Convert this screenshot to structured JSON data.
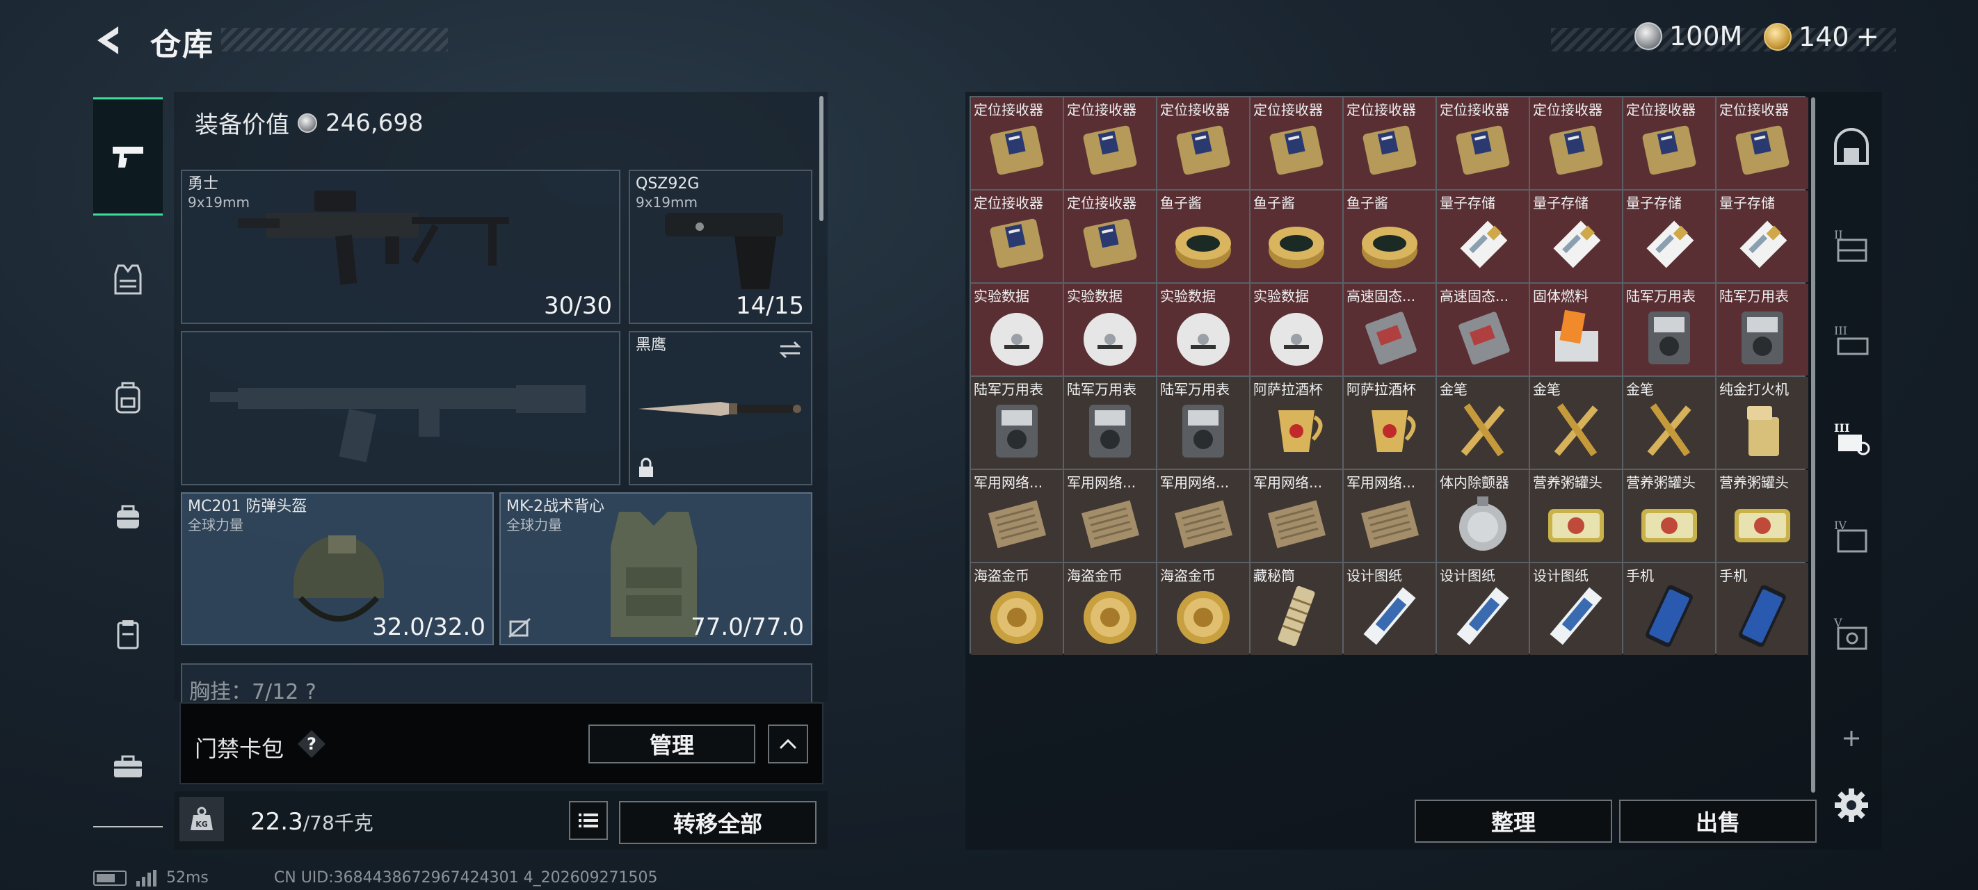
{
  "header": {
    "title": "仓库",
    "currency_silver": "100M",
    "currency_gold": "140",
    "plus_label": "+"
  },
  "left_rail": {
    "items": [
      {
        "name": "weapons",
        "icon": "pistol-icon",
        "active": true
      },
      {
        "name": "vests",
        "icon": "vest-icon"
      },
      {
        "name": "backpacks",
        "icon": "backpack-icon"
      },
      {
        "name": "bags",
        "icon": "bag-icon"
      },
      {
        "name": "containers",
        "icon": "clipboard-icon"
      },
      {
        "name": "toolbox",
        "icon": "toolbox-icon"
      }
    ]
  },
  "equipment": {
    "value_label": "装备价值",
    "value": "246,698",
    "primary": {
      "name": "勇士",
      "caliber": "9x19mm",
      "ammo": "30/30"
    },
    "sidearm": {
      "name": "QSZ92G",
      "caliber": "9x19mm",
      "ammo": "14/15"
    },
    "melee": {
      "name": "黑鹰"
    },
    "helmet": {
      "name": "MC201 防弹头盔",
      "brand": "全球力量",
      "durability": "32.0/32.0"
    },
    "armor": {
      "name": "MK-2战术背心",
      "brand": "全球力量",
      "durability": "77.0/77.0"
    },
    "chest_partial": "胸挂：7/12   ?",
    "card_pack_label": "门禁卡包",
    "manage_label": "管理",
    "weight_value": "22.3",
    "weight_unit": "/78千克",
    "transfer_label": "转移全部"
  },
  "status": {
    "latency": "52ms",
    "uid": "CN UID:3684438672967424301 4_202609271505"
  },
  "storage": {
    "sort_label": "整理",
    "sell_label": "出售",
    "items": [
      {
        "name": "定位接收器",
        "kind": "receiver",
        "bg": "red"
      },
      {
        "name": "定位接收器",
        "kind": "receiver",
        "bg": "red"
      },
      {
        "name": "定位接收器",
        "kind": "receiver",
        "bg": "red"
      },
      {
        "name": "定位接收器",
        "kind": "receiver",
        "bg": "red"
      },
      {
        "name": "定位接收器",
        "kind": "receiver",
        "bg": "red"
      },
      {
        "name": "定位接收器",
        "kind": "receiver",
        "bg": "red"
      },
      {
        "name": "定位接收器",
        "kind": "receiver",
        "bg": "red"
      },
      {
        "name": "定位接收器",
        "kind": "receiver",
        "bg": "red"
      },
      {
        "name": "定位接收器",
        "kind": "receiver",
        "bg": "red"
      },
      {
        "name": "定位接收器",
        "kind": "receiver",
        "bg": "red"
      },
      {
        "name": "定位接收器",
        "kind": "receiver",
        "bg": "red"
      },
      {
        "name": "鱼子酱",
        "kind": "caviar",
        "bg": "red"
      },
      {
        "name": "鱼子酱",
        "kind": "caviar",
        "bg": "red"
      },
      {
        "name": "鱼子酱",
        "kind": "caviar",
        "bg": "red"
      },
      {
        "name": "量子存储",
        "kind": "usb",
        "bg": "red"
      },
      {
        "name": "量子存储",
        "kind": "usb",
        "bg": "red"
      },
      {
        "name": "量子存储",
        "kind": "usb",
        "bg": "red"
      },
      {
        "name": "量子存储",
        "kind": "usb",
        "bg": "red"
      },
      {
        "name": "实验数据",
        "kind": "disc",
        "bg": "red"
      },
      {
        "name": "实验数据",
        "kind": "disc",
        "bg": "red"
      },
      {
        "name": "实验数据",
        "kind": "disc",
        "bg": "red"
      },
      {
        "name": "实验数据",
        "kind": "disc",
        "bg": "red"
      },
      {
        "name": "高速固态...",
        "kind": "ssd",
        "bg": "red"
      },
      {
        "name": "高速固态...",
        "kind": "ssd",
        "bg": "red"
      },
      {
        "name": "固体燃料",
        "kind": "fuel",
        "bg": "red"
      },
      {
        "name": "陆军万用表",
        "kind": "meter",
        "bg": "red"
      },
      {
        "name": "陆军万用表",
        "kind": "meter",
        "bg": "red"
      },
      {
        "name": "陆军万用表",
        "kind": "meter",
        "bg": "brown"
      },
      {
        "name": "陆军万用表",
        "kind": "meter",
        "bg": "brown"
      },
      {
        "name": "陆军万用表",
        "kind": "meter",
        "bg": "brown"
      },
      {
        "name": "阿萨拉酒杯",
        "kind": "cup",
        "bg": "brown"
      },
      {
        "name": "阿萨拉酒杯",
        "kind": "cup",
        "bg": "brown"
      },
      {
        "name": "金笔",
        "kind": "pen",
        "bg": "brown"
      },
      {
        "name": "金笔",
        "kind": "pen",
        "bg": "brown"
      },
      {
        "name": "金笔",
        "kind": "pen",
        "bg": "brown"
      },
      {
        "name": "纯金打火机",
        "kind": "lighter",
        "bg": "brown"
      },
      {
        "name": "军用网络...",
        "kind": "network",
        "bg": "brown"
      },
      {
        "name": "军用网络...",
        "kind": "network",
        "bg": "brown"
      },
      {
        "name": "军用网络...",
        "kind": "network",
        "bg": "brown"
      },
      {
        "name": "军用网络...",
        "kind": "network",
        "bg": "brown"
      },
      {
        "name": "军用网络...",
        "kind": "network",
        "bg": "brown"
      },
      {
        "name": "体内除颤器",
        "kind": "defib",
        "bg": "brown"
      },
      {
        "name": "营养粥罐头",
        "kind": "can",
        "bg": "brown"
      },
      {
        "name": "营养粥罐头",
        "kind": "can",
        "bg": "brown"
      },
      {
        "name": "营养粥罐头",
        "kind": "can",
        "bg": "brown"
      },
      {
        "name": "海盗金币",
        "kind": "coin",
        "bg": "brown"
      },
      {
        "name": "海盗金币",
        "kind": "coin",
        "bg": "brown"
      },
      {
        "name": "海盗金币",
        "kind": "coin",
        "bg": "brown"
      },
      {
        "name": "藏秘筒",
        "kind": "cryptex",
        "bg": "brown"
      },
      {
        "name": "设计图纸",
        "kind": "blueprint",
        "bg": "brown"
      },
      {
        "name": "设计图纸",
        "kind": "blueprint",
        "bg": "brown"
      },
      {
        "name": "设计图纸",
        "kind": "blueprint",
        "bg": "brown"
      },
      {
        "name": "手机",
        "kind": "phone",
        "bg": "brown"
      },
      {
        "name": "手机",
        "kind": "phone",
        "bg": "brown"
      }
    ]
  },
  "right_rail": {
    "items": [
      {
        "name": "storage-main",
        "icon": "vault-icon"
      },
      {
        "name": "storage-2",
        "icon": "shelf-2-icon"
      },
      {
        "name": "storage-3",
        "icon": "shelf-3-icon"
      },
      {
        "name": "storage-3b",
        "icon": "shelf-3b-icon"
      },
      {
        "name": "storage-4",
        "icon": "shelf-4-icon"
      },
      {
        "name": "storage-5",
        "icon": "shelf-5-icon"
      },
      {
        "name": "add-storage",
        "icon": "plus-icon"
      },
      {
        "name": "settings",
        "icon": "gear-icon"
      }
    ]
  },
  "colors": {
    "accent": "#3ddc9b",
    "cell_red": "#5a2f33",
    "cell_brown": "#3e3633"
  }
}
